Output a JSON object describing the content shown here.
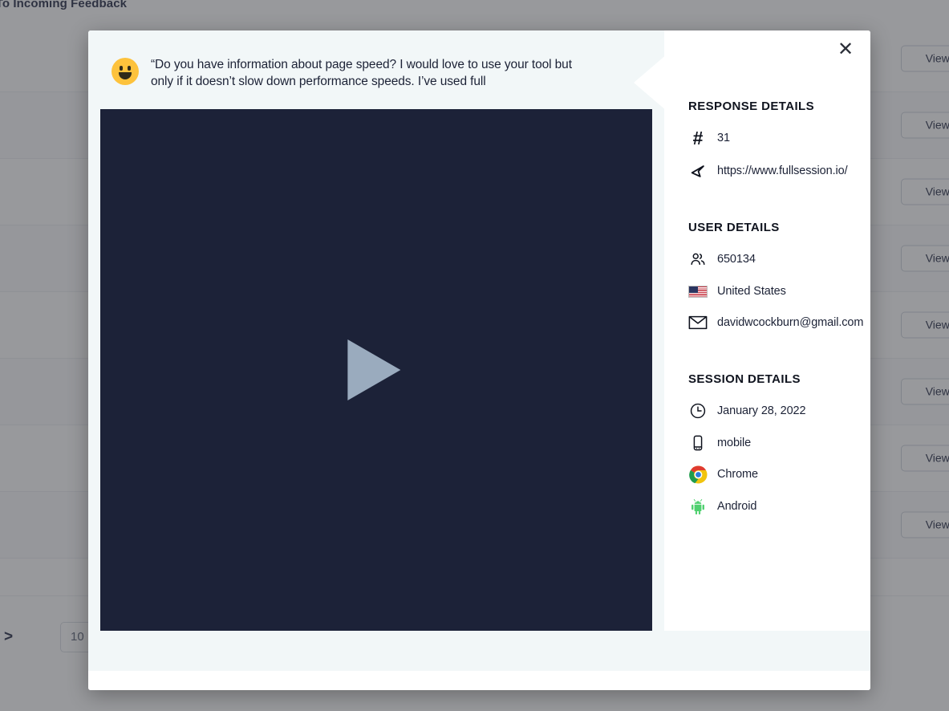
{
  "background": {
    "page_title": "k To Incoming Feedback",
    "rows": [
      {
        "action_label": "View F"
      },
      {
        "action_label": "View F"
      },
      {
        "action_label": "View F"
      },
      {
        "action_label": "View F"
      },
      {
        "action_label": "View F"
      },
      {
        "action_label": "View F"
      },
      {
        "action_label": "View F"
      },
      {
        "action_label": "View F"
      }
    ],
    "pagination": {
      "next_arrow": ">",
      "page_size_value": "10"
    }
  },
  "modal": {
    "close_label": "✕",
    "feedback": {
      "emoji": "slightly-smiling-face",
      "quote": "“Do you have information about page speed? I would love to use your tool but only if it doesn’t slow down performance speeds. I’ve used full"
    },
    "video": {
      "play_label": "play-button"
    },
    "sections": [
      {
        "heading": "RESPONSE DETAILS",
        "items": [
          {
            "icon": "hash-icon",
            "value": "31"
          },
          {
            "icon": "cursor-arrow-icon",
            "value": "https://www.fullsession.io/"
          }
        ]
      },
      {
        "heading": "USER DETAILS",
        "items": [
          {
            "icon": "users-icon",
            "value": "650134"
          },
          {
            "icon": "us-flag-icon",
            "value": "United States"
          },
          {
            "icon": "envelope-icon",
            "value": "davidwcockburn@gmail.com"
          }
        ]
      },
      {
        "heading": "SESSION DETAILS",
        "items": [
          {
            "icon": "clock-icon",
            "value": "January 28, 2022"
          },
          {
            "icon": "mobile-phone-icon",
            "value": "mobile"
          },
          {
            "icon": "chrome-icon",
            "value": "Chrome"
          },
          {
            "icon": "android-icon",
            "value": "Android"
          }
        ]
      }
    ]
  },
  "colors": {
    "video_bg": "#1c2238",
    "play_triangle": "#9aabbe",
    "header_bg": "#f2f7f8",
    "emoji_yellow": "#fdc23c",
    "text_dark": "#1c2236"
  }
}
